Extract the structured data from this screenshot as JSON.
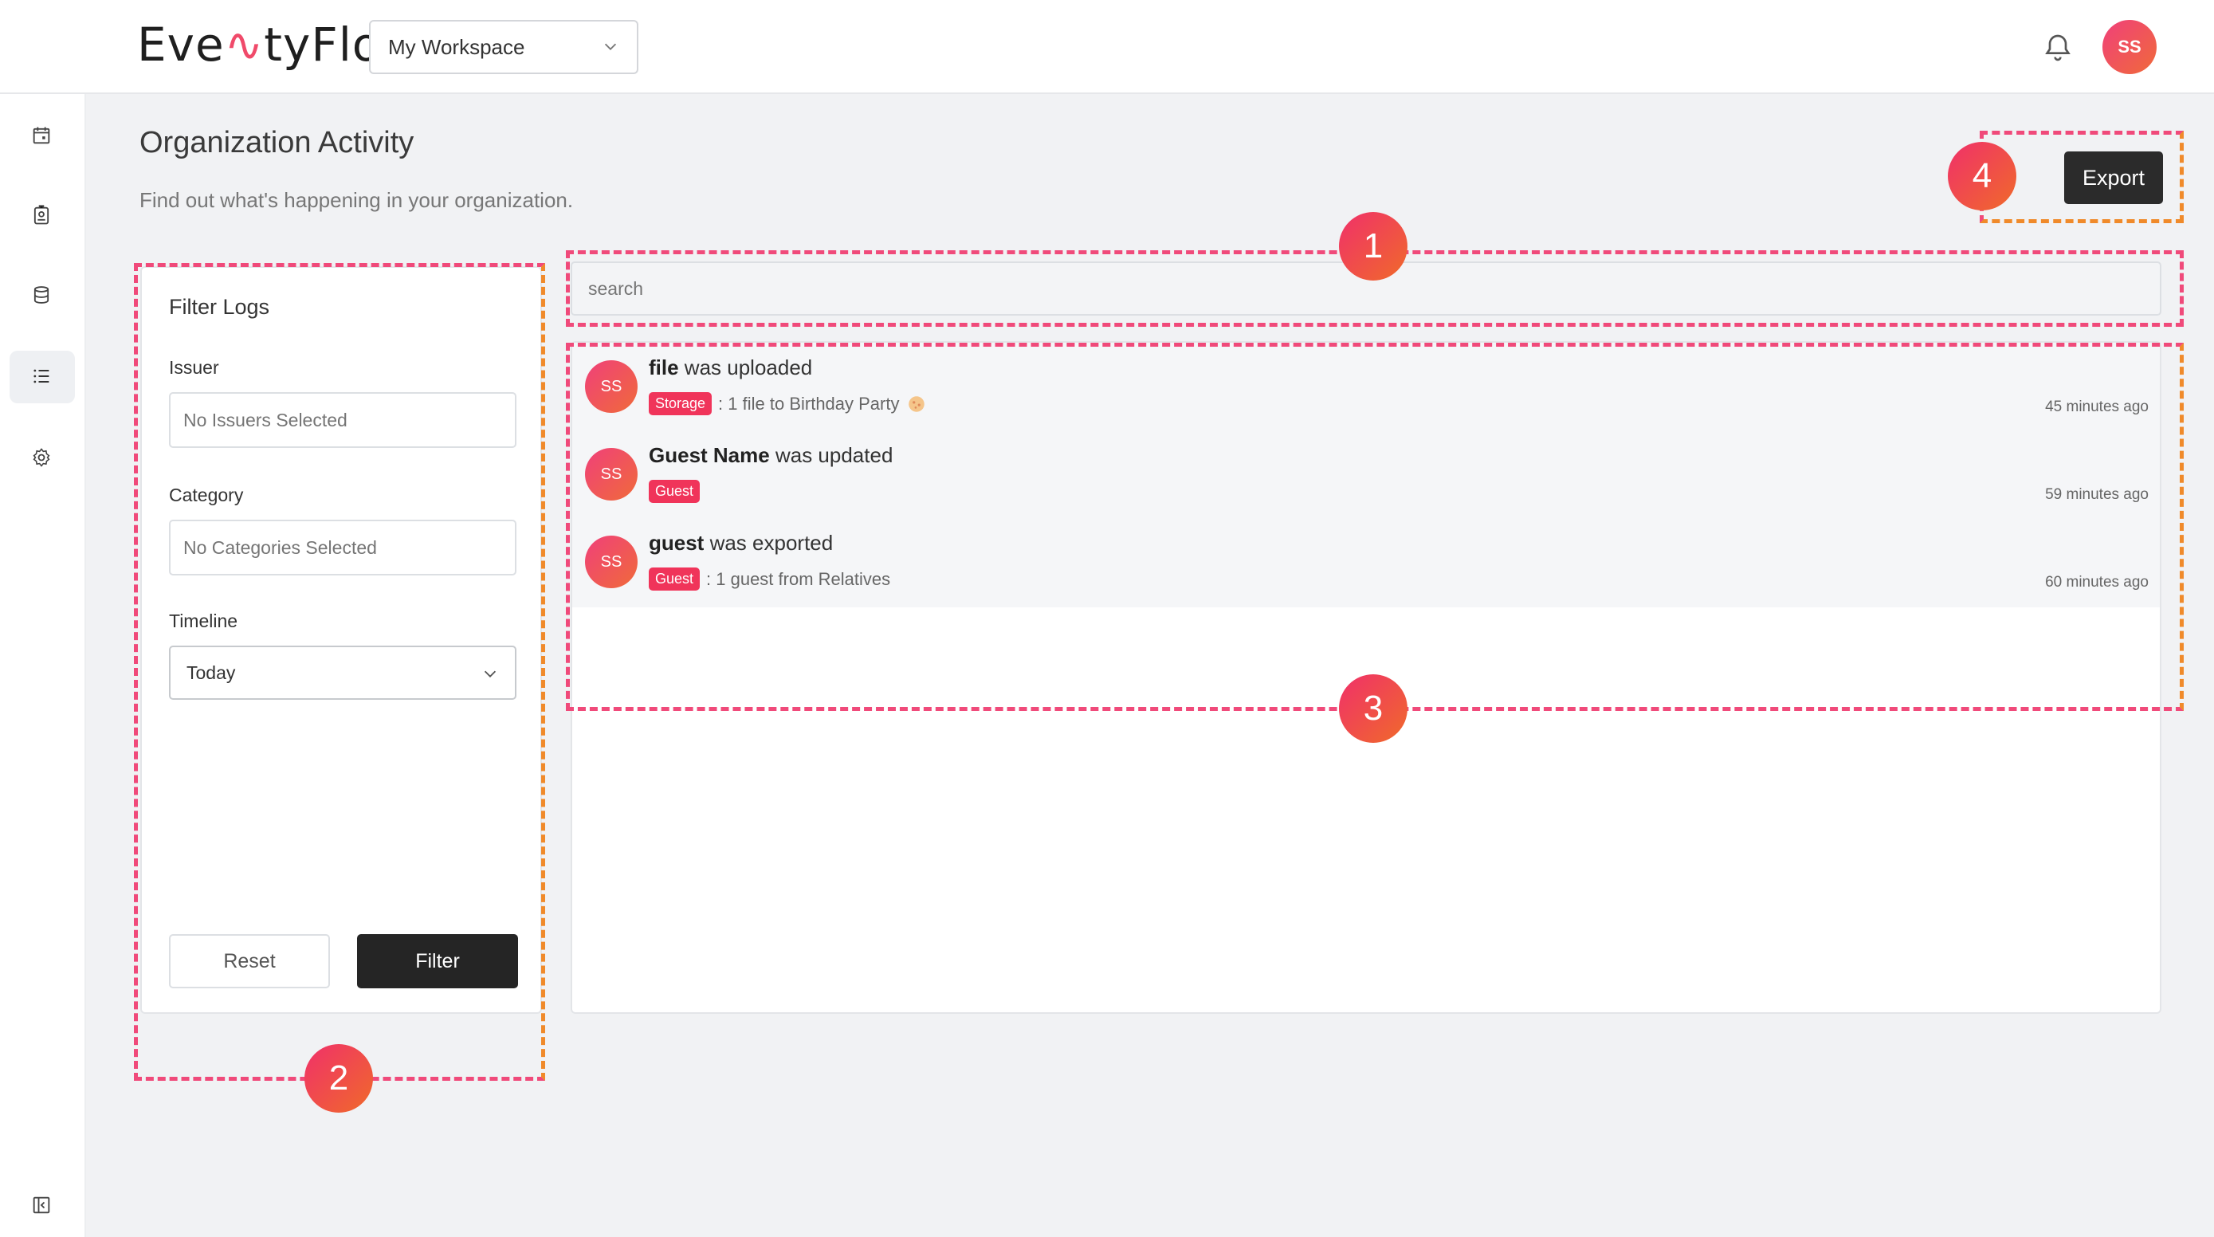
{
  "header": {
    "logo_text": "EventyFlo",
    "workspace": "My Workspace",
    "user_initials": "SS"
  },
  "page": {
    "title": "Organization Activity",
    "subtitle": "Find out what's happening in your organization.",
    "export_label": "Export"
  },
  "filter": {
    "title": "Filter Logs",
    "issuer_label": "Issuer",
    "issuer_placeholder": "No Issuers Selected",
    "category_label": "Category",
    "category_placeholder": "No Categories Selected",
    "timeline_label": "Timeline",
    "timeline_value": "Today",
    "reset_label": "Reset",
    "filter_label": "Filter"
  },
  "search": {
    "placeholder": "search"
  },
  "activities": [
    {
      "initials": "SS",
      "subject": "file",
      "action": " was uploaded",
      "tag": "Storage",
      "detail": ": 1 file to Birthday Party",
      "time": "45 minutes ago"
    },
    {
      "initials": "SS",
      "subject": "Guest Name",
      "action": " was updated",
      "tag": "Guest",
      "detail": "",
      "time": "59 minutes ago"
    },
    {
      "initials": "SS",
      "subject": "guest",
      "action": " was exported",
      "tag": "Guest",
      "detail": ": 1 guest from Relatives",
      "time": "60 minutes ago"
    }
  ],
  "annotations": {
    "one": "1",
    "two": "2",
    "three": "3",
    "four": "4"
  },
  "colors": {
    "accent": "#f0345a",
    "dark_button": "#252525",
    "annotation_pink": "#f04a7a",
    "annotation_orange": "#f08a2a"
  }
}
